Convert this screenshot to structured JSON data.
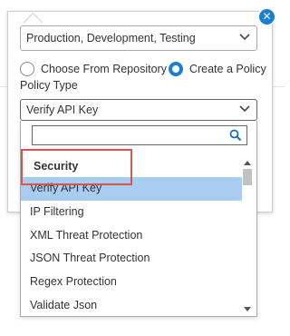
{
  "popover": {
    "close_icon": "close-circle-icon",
    "environment_select": {
      "value": "Production, Development, Testing",
      "icon": "chevron-down-icon"
    },
    "radio_group": {
      "options": [
        {
          "label": "Choose From Repository",
          "checked": false
        },
        {
          "label": "Create a Policy",
          "checked": true
        }
      ]
    },
    "policy_type": {
      "label": "Policy Type",
      "value": "Verify API Key",
      "icon": "chevron-down-icon"
    }
  },
  "dropdown": {
    "search": {
      "value": "",
      "placeholder": "",
      "icon": "search-icon"
    },
    "group_label": "Security",
    "options": [
      {
        "label": "Verify API Key",
        "selected": true
      },
      {
        "label": "IP Filtering",
        "selected": false
      },
      {
        "label": "XML Threat Protection",
        "selected": false
      },
      {
        "label": "JSON Threat Protection",
        "selected": false
      },
      {
        "label": "Regex Protection",
        "selected": false
      },
      {
        "label": "Validate Json",
        "selected": false
      }
    ]
  },
  "colors": {
    "accent": "#1a7fd4",
    "selected_bg": "#a8cdf0",
    "highlight": "#d9534f"
  }
}
